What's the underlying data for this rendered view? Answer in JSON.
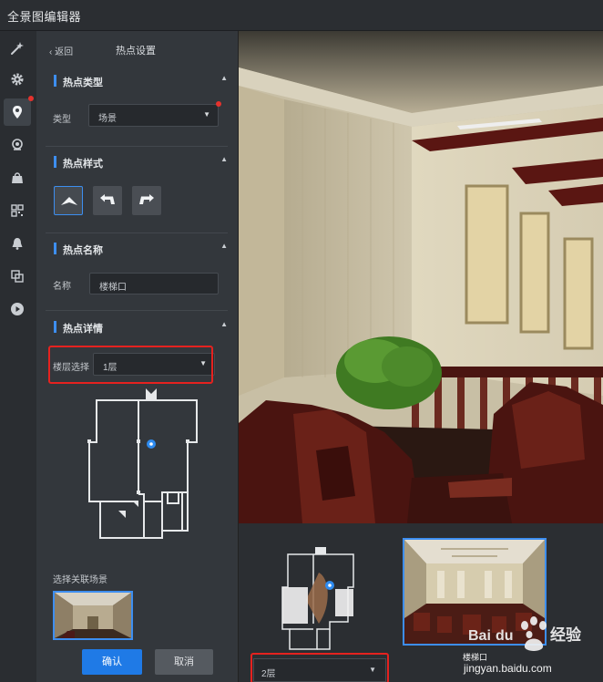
{
  "app": {
    "title": "全景图编辑器"
  },
  "rail": {
    "icons": [
      "magic-wand-icon",
      "gear-icon",
      "location-pin-icon",
      "camera-icon",
      "bag-icon",
      "grid-icon",
      "bell-icon",
      "copy-icon",
      "play-icon"
    ]
  },
  "panel": {
    "back_label": "返回",
    "title": "热点设置",
    "section_type": {
      "title": "热点类型",
      "field_label": "类型",
      "value": "场景"
    },
    "section_style": {
      "title": "热点样式"
    },
    "section_name": {
      "title": "热点名称",
      "field_label": "名称",
      "value": "楼梯口"
    },
    "section_detail": {
      "title": "热点详情",
      "floor_label": "楼层选择",
      "floor_value": "1层",
      "assoc_label": "选择关联场景"
    },
    "confirm_label": "确认",
    "cancel_label": "取消"
  },
  "bottom": {
    "floor_value": "2层",
    "scene_name": "楼梯口"
  },
  "watermark": {
    "brand": "Bai du 经验",
    "url": "jingyan.baidu.com"
  },
  "colors": {
    "accent": "#3d8ef0",
    "confirm": "#1f7ae6",
    "highlight": "#e5221f"
  }
}
